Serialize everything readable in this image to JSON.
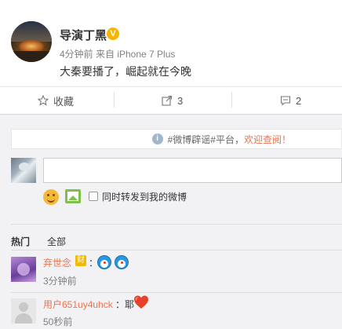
{
  "post": {
    "author": "导演丁黑",
    "verified_badge": "V",
    "meta": "4分钟前 来自 iPhone 7 Plus",
    "content": "大秦要播了，崛起就在今晚"
  },
  "actions": {
    "favorite_label": "收藏",
    "forward_count": "3",
    "comment_count": "2"
  },
  "comments_panel": {
    "notice_icon": "i",
    "notice_text": "#微博辟谣#平台，",
    "notice_link": "欢迎查阅！",
    "forward_checkbox_label": "同时转发到我的微博",
    "checkbox_checked": false,
    "tabs": [
      "热门",
      "全部"
    ],
    "comments": [
      {
        "user": "弃世念",
        "badge": "财",
        "text": "：",
        "emojis": [
          "doraemon-icon",
          "doraemon-icon"
        ],
        "time": "3分钟前"
      },
      {
        "user": "用户651uy4uhck",
        "text": "：耶",
        "emojis": [
          "heart-icon"
        ],
        "time": "50秒前"
      }
    ]
  },
  "colors": {
    "accent_orange": "#eb7350",
    "verified_gold": "#f7b500",
    "panel_bg": "#f2f2f5"
  }
}
